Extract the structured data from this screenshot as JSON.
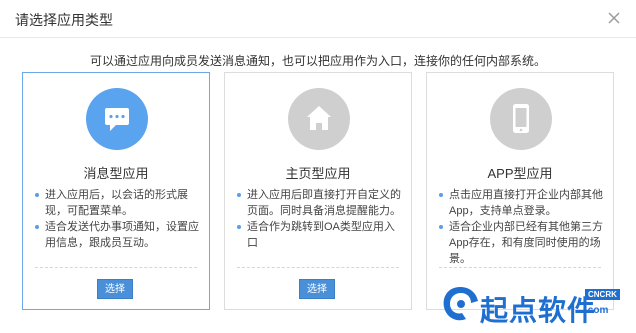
{
  "dialog": {
    "title": "请选择应用类型",
    "intro": "可以通过应用向成员发送消息通知，也可以把应用作为入口，连接你的任何内部系统。"
  },
  "cards": [
    {
      "title": "消息型应用",
      "icon": "chat-bubble-icon",
      "selected": true,
      "bullets": [
        "进入应用后，以会话的形式展现，可配置菜单。",
        "适合发送代办事项通知，设置应用信息，跟成员互动。"
      ],
      "button": "选择"
    },
    {
      "title": "主页型应用",
      "icon": "home-icon",
      "selected": false,
      "bullets": [
        "进入应用后即直接打开自定义的页面。同时具备消息提醒能力。",
        "适合作为跳转到OA类型应用入口"
      ],
      "button": "选择"
    },
    {
      "title": "APP型应用",
      "icon": "phone-icon",
      "selected": false,
      "bullets": [
        "点击应用直接打开企业内部其他App，支持单点登录。",
        "适合企业内部已经有其他第三方App存在，和有度同时使用的场景。"
      ]
    }
  ],
  "watermark": {
    "text": "起点软件",
    "badge": "CNCRK",
    "sub": ".com"
  },
  "colors": {
    "accent": "#5aa3ee",
    "button": "#4a90d9",
    "icon_inactive": "#cfcfcf",
    "selected_border": "#6fa8e6"
  }
}
